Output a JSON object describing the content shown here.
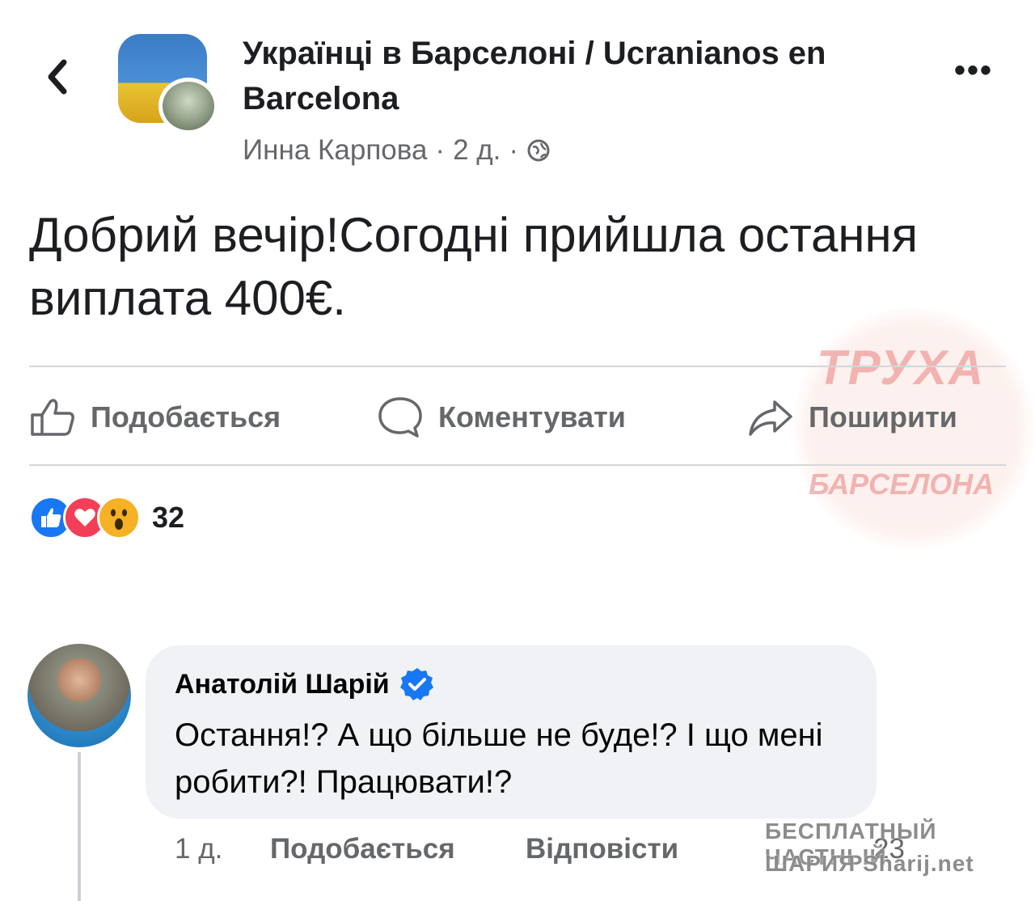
{
  "header": {
    "group_name": "Українці в Барселоні / Ucranianos en Barcelona",
    "author": "Инна Карпова",
    "time": "2 д.",
    "separator": "·",
    "back_icon": "chevron-left-icon",
    "more_icon": "more-horizontal-icon",
    "more_label": "•••"
  },
  "post": {
    "text": "Добрий вечір!Согодні прийшла остання виплата 400€."
  },
  "actions": {
    "like": "Подобається",
    "comment": "Коментувати",
    "share": "Поширити"
  },
  "reactions": {
    "count": "32",
    "types": [
      "like",
      "love",
      "wow"
    ]
  },
  "comment": {
    "author": "Анатолій Шарій",
    "verified": true,
    "text": "Остання!? А що більше не буде!? І що мені робити?! Працювати!?",
    "time": "1 д.",
    "like": "Подобається",
    "reply": "Відповісти",
    "reaction_count": "23"
  },
  "watermarks": {
    "top": "ТРУХА",
    "bottom": "БАРСЕЛОНА",
    "line1": "БЕСПЛАТНЫЙ ЧАСТНЫЙ",
    "line2": "ШАРИЯ Sharij.net"
  },
  "colors": {
    "accent": "#1877f2",
    "text": "#1c1e21",
    "secondary": "#65676b",
    "bubble": "#f0f2f5",
    "love": "#f33e58",
    "wow": "#f7b125"
  }
}
